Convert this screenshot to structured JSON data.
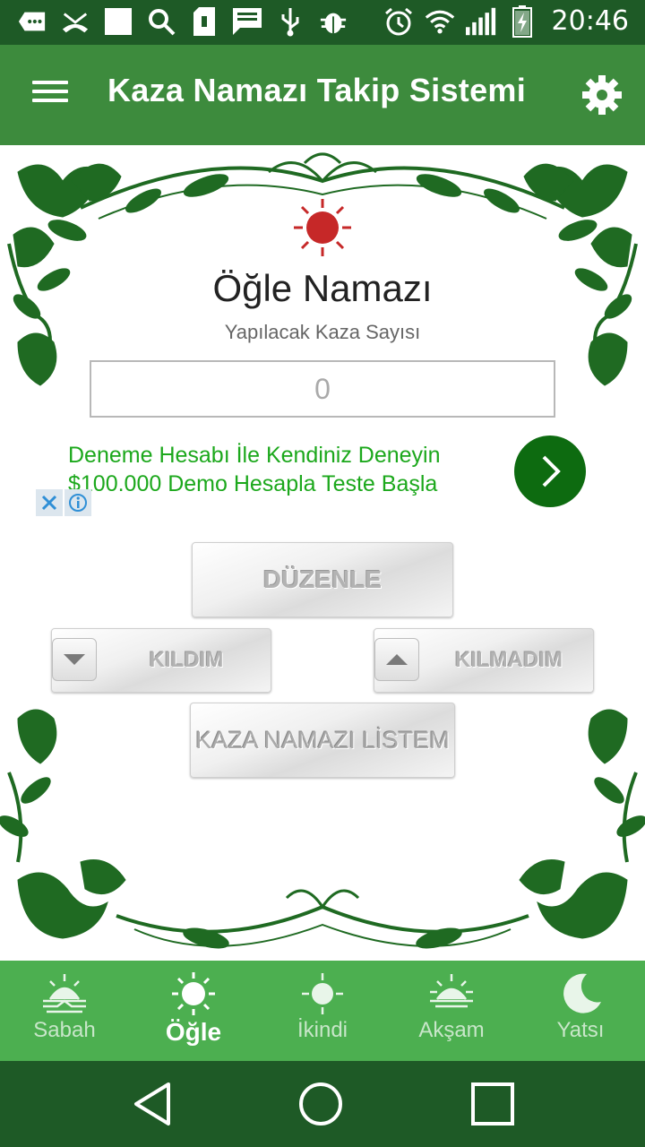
{
  "status_bar": {
    "time": "20:46",
    "left_icons": [
      "message-icon",
      "missed-call-icon",
      "notification-square-icon",
      "search-icon",
      "sd-card-icon",
      "chat-icon",
      "usb-icon",
      "bug-icon"
    ],
    "right_icons": [
      "alarm-icon",
      "wifi-icon",
      "signal-icon",
      "battery-charging-icon"
    ]
  },
  "app_bar": {
    "title": "Kaza Namazı Takip Sistemi",
    "menu_icon": "menu-icon",
    "settings_icon": "gear-icon"
  },
  "prayer": {
    "title": "Öğle Namazı",
    "subtitle": "Yapılacak Kaza Sayısı",
    "count": "0",
    "icon": "red-sun-icon",
    "icon_color": "#c62828"
  },
  "ad": {
    "line1": "Deneme Hesabı İle Kendiniz Deneyin",
    "line2": "$100.000 Demo Hesapla Teste Başla",
    "text_color": "#1ca81c",
    "button_color": "#0d6b10"
  },
  "buttons": {
    "edit": "DÜZENLE",
    "done": "KILDIM",
    "not_done": "KILMADIM",
    "list": "KAZA NAMAZI LİSTEM"
  },
  "tabs": [
    {
      "label": "Sabah",
      "icon": "sunrise-icon",
      "active": false
    },
    {
      "label": "Öğle",
      "icon": "sun-icon",
      "active": true
    },
    {
      "label": "İkindi",
      "icon": "afternoon-sun-icon",
      "active": false
    },
    {
      "label": "Akşam",
      "icon": "sunset-icon",
      "active": false
    },
    {
      "label": "Yatsı",
      "icon": "moon-icon",
      "active": false
    }
  ],
  "colors": {
    "status_bar": "#1e5a26",
    "app_bar": "#3d8b3d",
    "bottom_nav": "#4caf50",
    "vine": "#1f6a22"
  }
}
